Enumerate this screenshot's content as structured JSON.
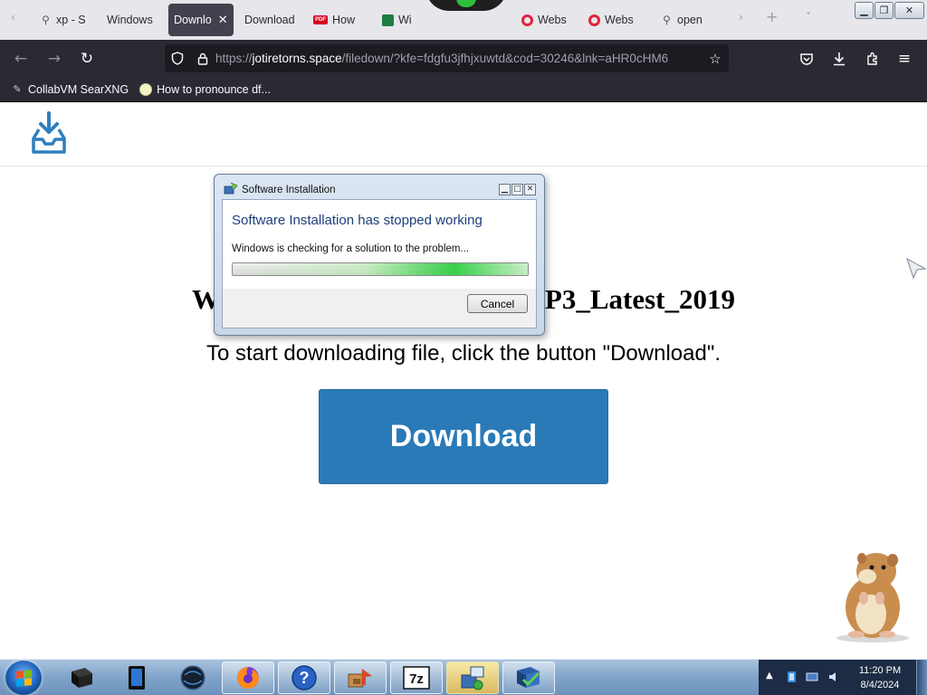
{
  "browser": {
    "tabs": [
      {
        "label": "",
        "icon": "back-arrow-icon",
        "active": false
      },
      {
        "label": "xp - S",
        "icon": "search-icon",
        "active": false
      },
      {
        "label": "Windows",
        "icon": "",
        "active": false
      },
      {
        "label": "Downlo",
        "icon": "",
        "active": true
      },
      {
        "label": "Download",
        "icon": "",
        "active": false
      },
      {
        "label": "How",
        "icon": "pdf-icon",
        "active": false
      },
      {
        "label": "Wi",
        "icon": "sheet-icon",
        "active": false
      },
      {
        "label": "Webs",
        "icon": "opera-icon",
        "active": false
      },
      {
        "label": "Webs",
        "icon": "opera-icon",
        "active": false
      },
      {
        "label": "open",
        "icon": "search-icon",
        "active": false
      }
    ],
    "url": {
      "scheme": "https://",
      "domain": "jotiretorns.space",
      "path": "/filedown/?kfe=fdgfu3jfhjxuwtd&cod=30246&lnk=aHR0cHM6"
    },
    "bookmarks": [
      {
        "label": "CollabVM SearXNG",
        "icon": "searxng-icon"
      },
      {
        "label": "How to pronounce df...",
        "icon": "globe-icon"
      }
    ]
  },
  "page": {
    "file_title": "Windows_XP_Professional_SP3_Latest_2019",
    "instruction": "To start downloading file, click the button \"Download\".",
    "download_button": "Download"
  },
  "dialog": {
    "title": "Software Installation",
    "heading": "Software Installation has stopped working",
    "message": "Windows is checking for a solution to the problem...",
    "cancel": "Cancel",
    "progress": 1.0
  },
  "taskbar": {
    "clock_time": "11:20 PM",
    "clock_date": "8/4/2024",
    "apps": [
      {
        "name": "media-center-icon"
      },
      {
        "name": "tablet-icon"
      },
      {
        "name": "globe-app-icon"
      },
      {
        "name": "firefox-icon"
      },
      {
        "name": "help-icon"
      },
      {
        "name": "setup-icon"
      },
      {
        "name": "7zip-icon"
      },
      {
        "name": "installer-icon"
      },
      {
        "name": "task-icon"
      }
    ]
  },
  "colors": {
    "download_button": "#2a7ab8",
    "tab_active": "#42414d",
    "toolbar": "#2b2a33",
    "dialog_heading": "#1e3f7b"
  }
}
